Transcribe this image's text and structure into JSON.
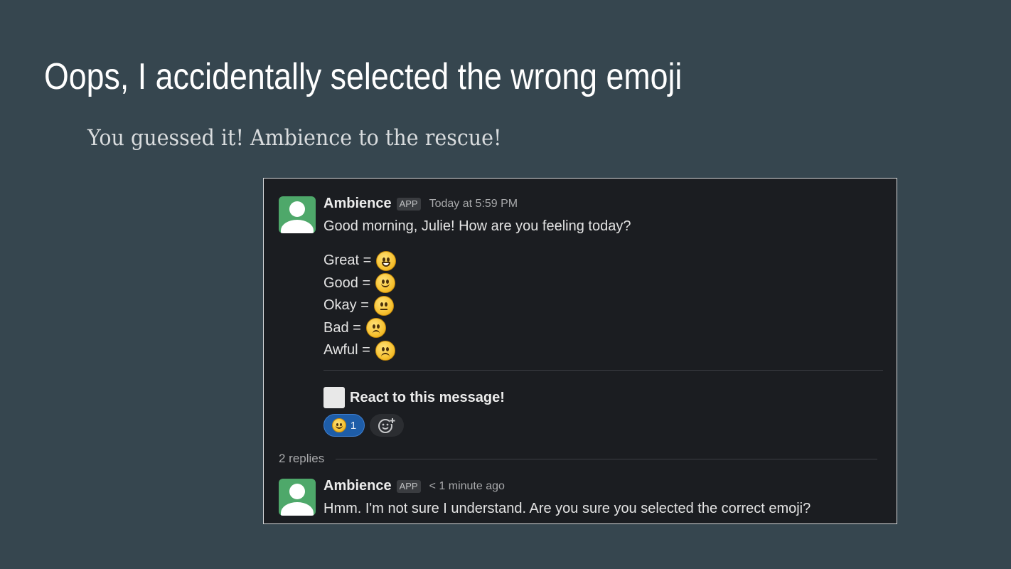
{
  "slide": {
    "title": "Oops, I accidentally selected the wrong emoji",
    "subtitle": "You guessed it! Ambience to the rescue!"
  },
  "message": {
    "sender": "Ambience",
    "badge": "APP",
    "timestamp": "Today at 5:59 PM",
    "greeting": "Good morning, Julie! How are you feeling today?",
    "options": [
      {
        "label": "Great =",
        "emoji": "grinning-face-icon"
      },
      {
        "label": "Good =",
        "emoji": "slightly-smiling-face-icon"
      },
      {
        "label": "Okay =",
        "emoji": "neutral-face-icon"
      },
      {
        "label": "Bad =",
        "emoji": "slightly-frowning-face-icon"
      },
      {
        "label": "Awful =",
        "emoji": "frowning-face-icon"
      }
    ],
    "prompt": "React to this message!",
    "reaction": {
      "emoji": "smiling-face-icon",
      "count": "1"
    },
    "add_reaction_icon": "add-reaction-icon"
  },
  "thread": {
    "replies_label": "2 replies"
  },
  "reply": {
    "sender": "Ambience",
    "badge": "APP",
    "timestamp": "< 1 minute ago",
    "text": "Hmm. I'm not sure I understand. Are you sure you selected the correct emoji?"
  },
  "colors": {
    "slide_background": "#36464f",
    "chat_background": "#1b1d21",
    "avatar": "#4ea86a",
    "reaction_selected": "#1e5da8"
  }
}
